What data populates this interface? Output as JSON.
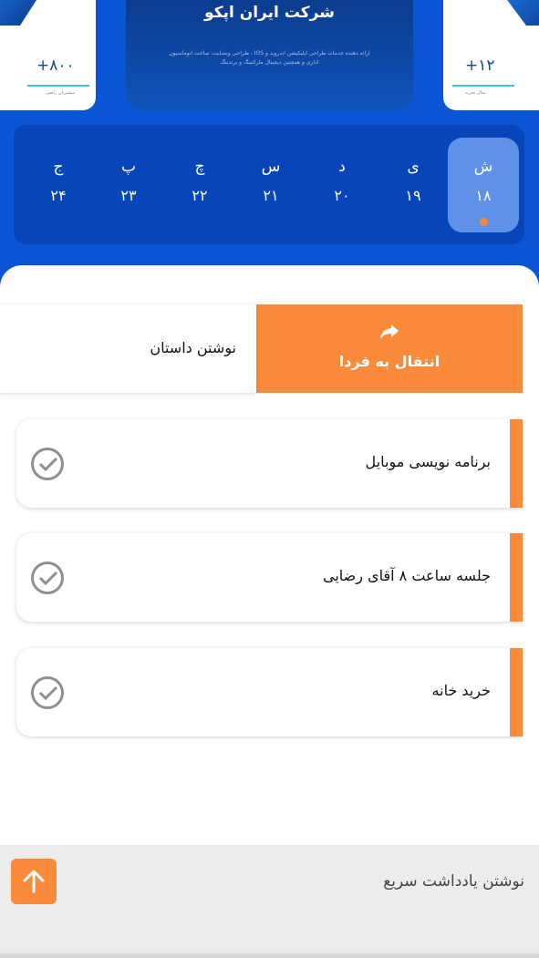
{
  "header": {
    "left_card": {
      "value": "+۸۰۰",
      "label": "مشتریان راضی"
    },
    "right_card": {
      "value": "+۱۲",
      "label": "سال تجربه"
    },
    "company": {
      "title": "شرکت ایران اپکو",
      "description": "ارائه دهنده خدمات طراحی اپلیکیشن اندروید و IOS ، طراحی وبسایت، ساخت اتوماسیون اداری و همچنین دیجیتال مارکتینگ و برندینگ"
    }
  },
  "days": [
    {
      "name": "ش",
      "num": "۱۸",
      "active": true
    },
    {
      "name": "ی",
      "num": "۱۹",
      "active": false
    },
    {
      "name": "د",
      "num": "۲۰",
      "active": false
    },
    {
      "name": "س",
      "num": "۲۱",
      "active": false
    },
    {
      "name": "چ",
      "num": "۲۲",
      "active": false
    },
    {
      "name": "پ",
      "num": "۲۳",
      "active": false
    },
    {
      "name": "ج",
      "num": "۲۴",
      "active": false
    }
  ],
  "swipe_item": {
    "text": "نوشتن داستان",
    "action_label": "انتقال به فردا",
    "action_icon": "share-forward-icon"
  },
  "tasks": [
    {
      "text": "برنامه نویسی موبایل"
    },
    {
      "text": "جلسه ساعت ۸ آقای رضایی"
    },
    {
      "text": "خرید خانه"
    }
  ],
  "quick_note": {
    "placeholder": "نوشتن یادداشت سریع",
    "send_icon": "arrow-up-icon"
  },
  "colors": {
    "primary_blue": "#0a55d6",
    "accent_orange": "#f98b3a",
    "active_day": "#5f91e8"
  }
}
